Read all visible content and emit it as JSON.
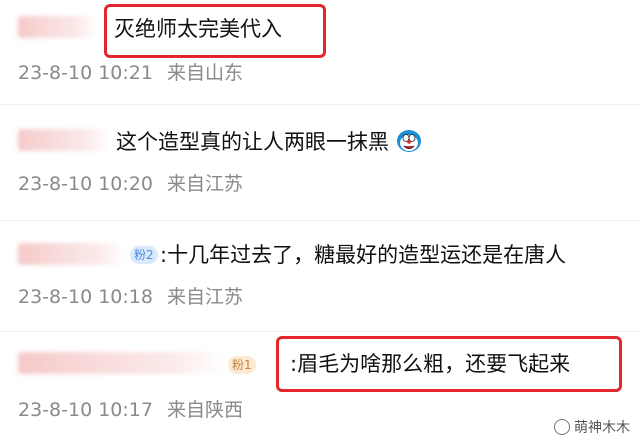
{
  "comments": [
    {
      "text": "灭绝师太完美代入",
      "date": "23-8-10",
      "time": "10:21",
      "location": "来自山东"
    },
    {
      "text": "这个造型真的让人两眼一抹黑",
      "date": "23-8-10",
      "time": "10:20",
      "location": "来自江苏"
    },
    {
      "text": ":十几年过去了，糖最好的造型运还是在唐人",
      "date": "23-8-10",
      "time": "10:18",
      "location": "来自江苏",
      "badge": "粉2"
    },
    {
      "text": ":眉毛为啥那么粗，还要飞起来",
      "date": "23-8-10",
      "time": "10:17",
      "location": "来自陕西",
      "badge": "粉1"
    }
  ],
  "watermark": {
    "text": "萌神木木"
  },
  "colors": {
    "highlight": "#e3262c",
    "meta": "#8a8a8a",
    "text": "#111111"
  }
}
